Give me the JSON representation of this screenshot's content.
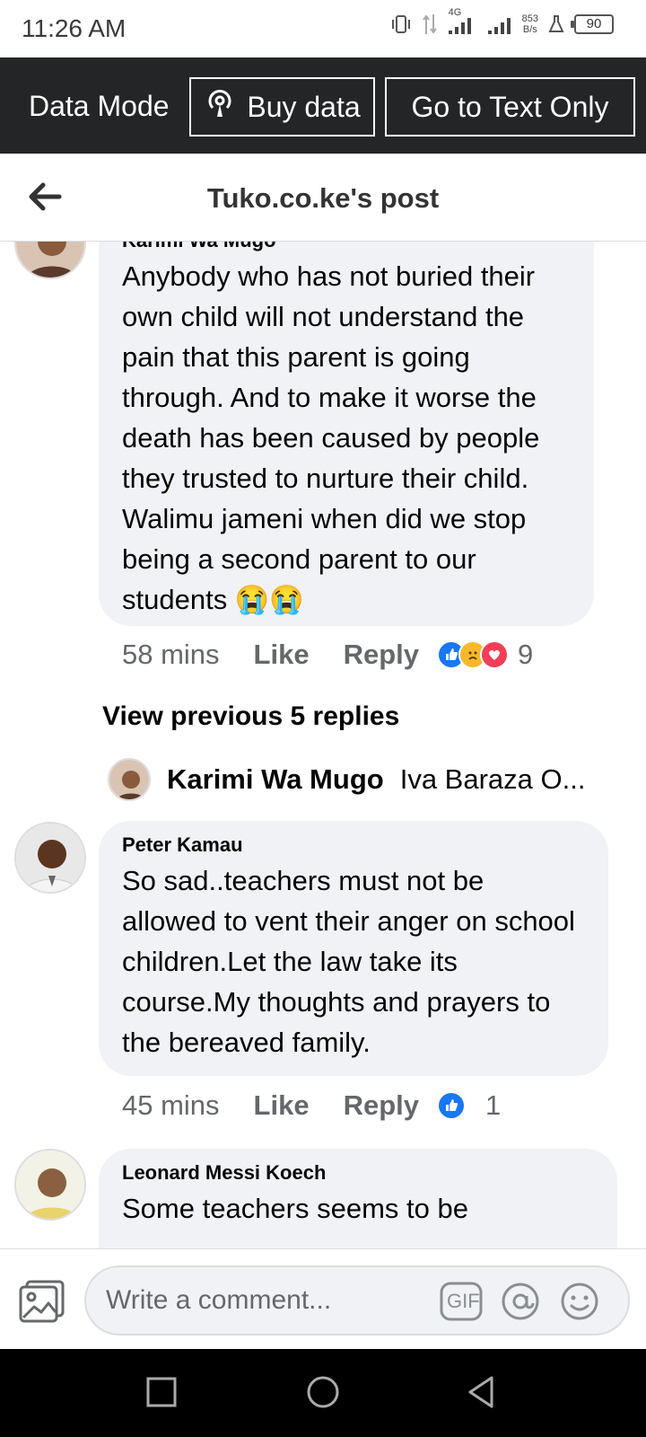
{
  "status": {
    "time": "11:26 AM",
    "net_label": "4G",
    "speed_value": "853",
    "speed_unit": "B/s",
    "battery": "90"
  },
  "data_bar": {
    "mode_label": "Data Mode",
    "buy_label": "Buy data",
    "text_only_label": "Go to Text Only"
  },
  "header": {
    "title": "Tuko.co.ke's post"
  },
  "comments": [
    {
      "author": "Karimi Wa Mugo",
      "text": "Anybody who has not buried their own child will not understand the pain that this parent is going through. And to make it worse the death has been caused by people they trusted to nurture their child. Walimu jameni when did we stop being a second parent to our students 😭😭",
      "time": "58 mins",
      "like": "Like",
      "reply": "Reply",
      "reaction_count": "9"
    },
    {
      "author": "Peter Kamau",
      "text": "So sad..teachers must not be allowed to vent their anger on school children.Let the law take its course.My thoughts and prayers to the bereaved family.",
      "time": "45 mins",
      "like": "Like",
      "reply": "Reply",
      "reaction_count": "1"
    },
    {
      "author": "Leonard Messi Koech",
      "text": "Some teachers seems to be"
    }
  ],
  "replies": {
    "view_previous": "View previous 5 replies",
    "preview_author": "Karimi Wa Mugo",
    "preview_text": "Iva Baraza O..."
  },
  "composer": {
    "placeholder": "Write a comment...",
    "gif_label": "GIF"
  },
  "colors": {
    "accent": "#1877f2",
    "bubble": "#f0f2f5",
    "data_bar": "#242526"
  }
}
